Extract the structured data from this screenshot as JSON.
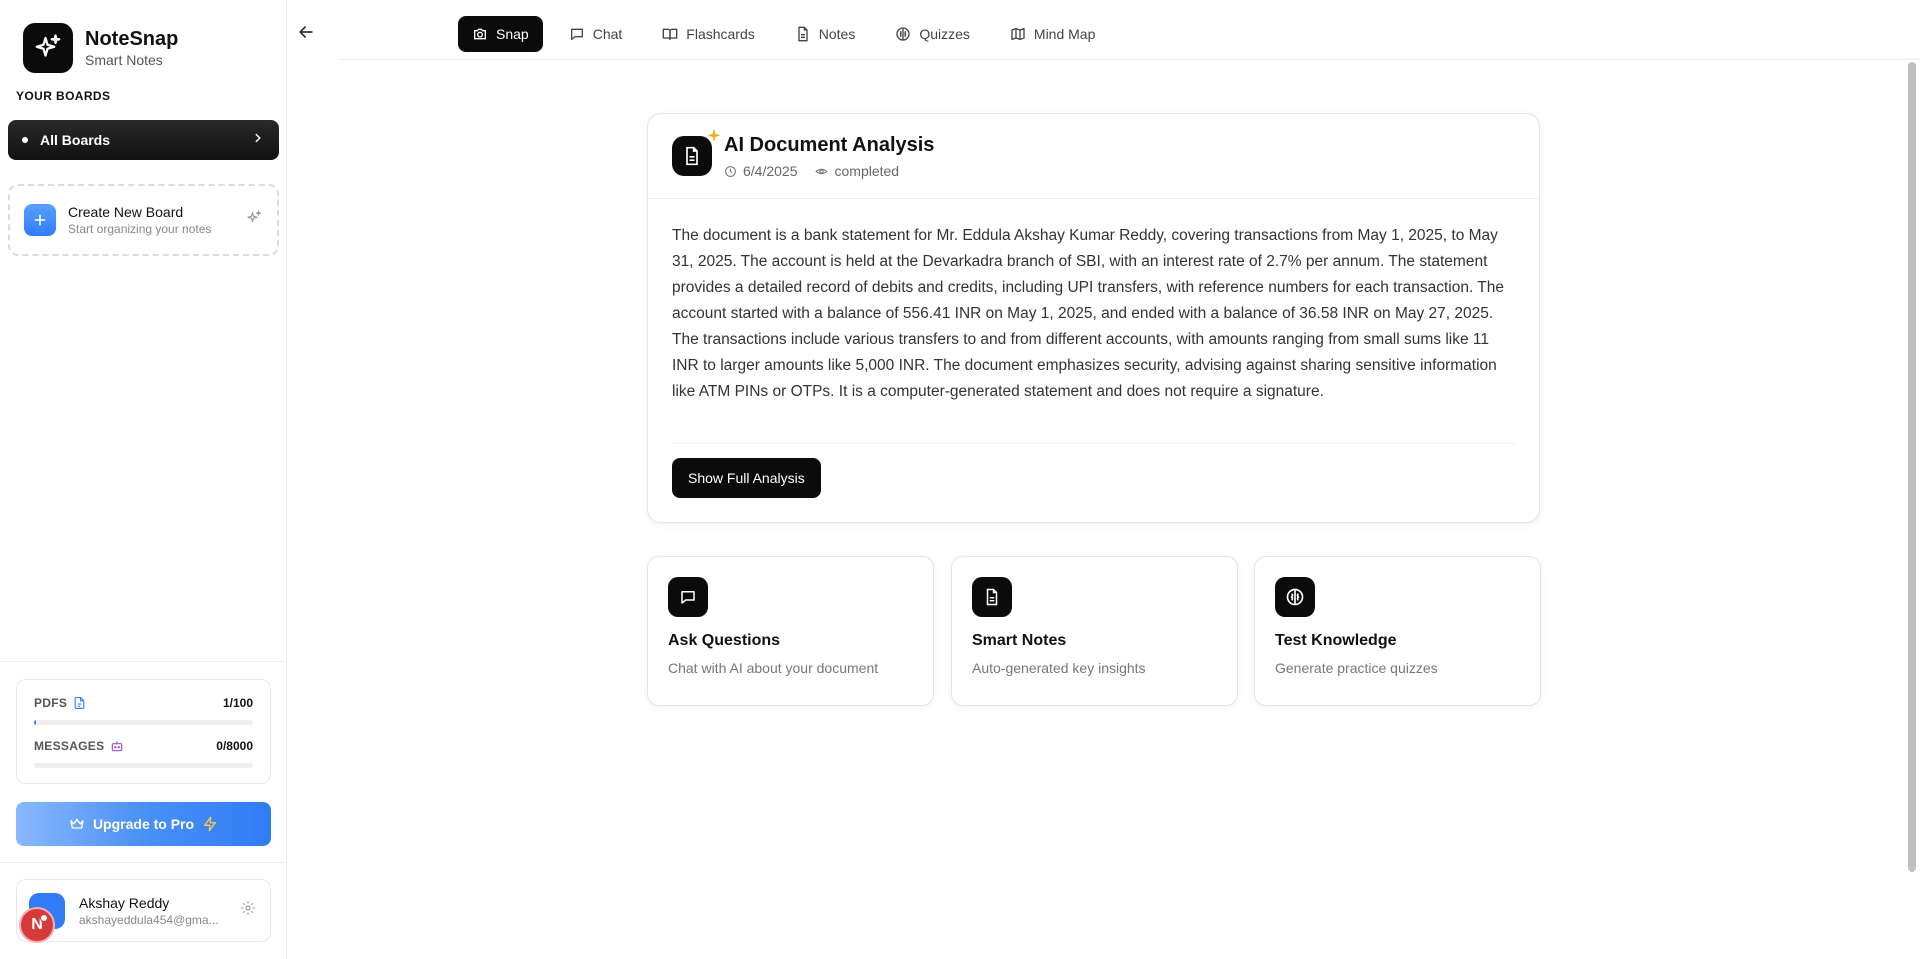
{
  "brand": {
    "name": "NoteSnap",
    "subtitle": "Smart Notes"
  },
  "sidebar": {
    "heading": "YOUR BOARDS",
    "all_boards_label": "All Boards",
    "create_board_title": "Create New Board",
    "create_board_subtitle": "Start organizing your notes"
  },
  "usage": {
    "pdfs_label": "PDFS",
    "pdfs_value": "1/100",
    "pdfs_fraction": 0.01,
    "messages_label": "MESSAGES",
    "messages_value": "0/8000",
    "messages_fraction": 0
  },
  "upgrade_label": "Upgrade to Pro",
  "user": {
    "name": "Akshay Reddy",
    "email": "akshayeddula454@gma...",
    "badge": "N"
  },
  "tabs": [
    {
      "label": "Snap",
      "icon": "camera-icon",
      "active": true
    },
    {
      "label": "Chat",
      "icon": "chat-icon"
    },
    {
      "label": "Flashcards",
      "icon": "book-icon"
    },
    {
      "label": "Notes",
      "icon": "document-icon"
    },
    {
      "label": "Quizzes",
      "icon": "brain-icon"
    },
    {
      "label": "Mind Map",
      "icon": "map-icon"
    }
  ],
  "analysis": {
    "title": "AI Document Analysis",
    "date": "6/4/2025",
    "status": "completed",
    "body": "The document is a bank statement for Mr. Eddula Akshay Kumar Reddy, covering transactions from May 1, 2025, to May 31, 2025. The account is held at the Devarkadra branch of SBI, with an interest rate of 2.7% per annum. The statement provides a detailed record of debits and credits, including UPI transfers, with reference numbers for each transaction. The account started with a balance of 556.41 INR on May 1, 2025, and ended with a balance of 36.58 INR on May 27, 2025. The transactions include various transfers to and from different accounts, with amounts ranging from small sums like 11 INR to larger amounts like 5,000 INR. The document emphasizes security, advising against sharing sensitive information like ATM PINs or OTPs. It is a computer-generated statement and does not require a signature.",
    "button_label": "Show Full Analysis"
  },
  "features": [
    {
      "title": "Ask Questions",
      "subtitle": "Chat with AI about your document",
      "icon": "chat-icon"
    },
    {
      "title": "Smart Notes",
      "subtitle": "Auto-generated key insights",
      "icon": "document-icon"
    },
    {
      "title": "Test Knowledge",
      "subtitle": "Generate practice quizzes",
      "icon": "brain-icon"
    }
  ],
  "colors": {
    "accent": "#2f7cf6",
    "dark": "#0b0b0b"
  }
}
